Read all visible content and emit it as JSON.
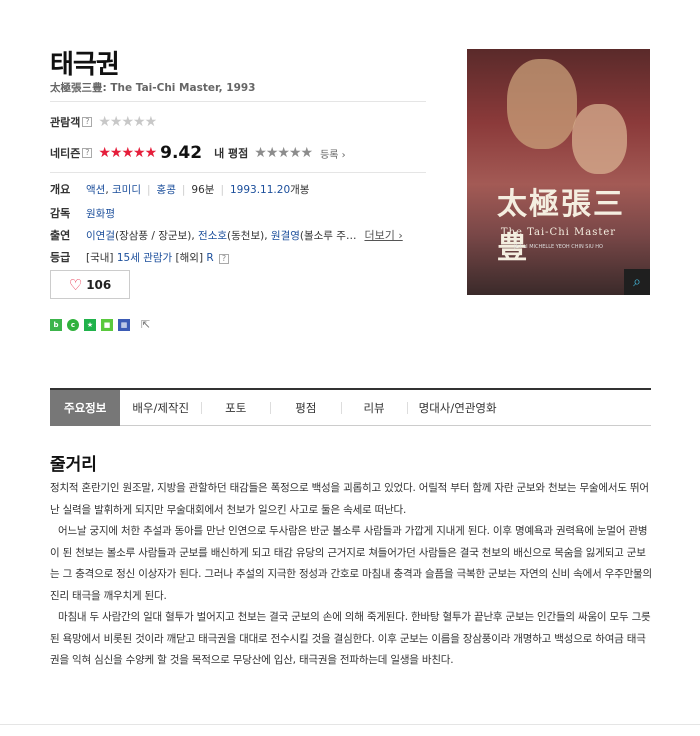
{
  "movie": {
    "title": "태극권",
    "subtitle": "太極張三豊: The Tai-Chi Master, 1993"
  },
  "ratings": {
    "audience_label": "관람객",
    "audience_help": "?",
    "netizen_label": "네티즌",
    "netizen_help": "?",
    "netizen_score": "9.42",
    "my_rating_label": "내 평점",
    "register_label": "등록 ›"
  },
  "info": {
    "overview_label": "개요",
    "genre_1": "액션",
    "genre_sep": ",",
    "genre_2": "코미디",
    "country": "홍콩",
    "runtime": "96분",
    "release_date": "1993.11.20",
    "release_suffix": "개봉",
    "director_label": "감독",
    "director": "원화평",
    "cast_label": "출연",
    "cast_1": "이연걸",
    "cast_1_role": "(장삼풍 / 장군보)",
    "cast_2": "전소호",
    "cast_2_role": "(동천보)",
    "cast_3": "원결영",
    "cast_3_role": "(볼소루 주…",
    "more_label": "더보기 ›",
    "rating_label": "등급",
    "rating_domestic": "[국내]",
    "rating_domestic_value": "15세 관람가",
    "rating_foreign": "[해외]",
    "rating_foreign_value": "R",
    "rating_help": "?"
  },
  "like": {
    "count": "106"
  },
  "poster": {
    "title_text": "太極張三豊",
    "english_title": "The Tai-Chi Master",
    "credits": "JET LI  MICHELLE YEOH  CHIN SIU HO",
    "zoom_icon": "magnifier-icon"
  },
  "tabs": [
    "주요정보",
    "배우/제작진",
    "포토",
    "평점",
    "리뷰",
    "명대사/연관영화"
  ],
  "synopsis": {
    "heading": "줄거리",
    "paragraphs": [
      "정치적 혼란기인 원조말, 지방을 관할하던 태감들은 폭정으로 백성을 괴롭히고 있었다. 어릴적 부터 함께 자란 군보와 천보는 무술에서도 뛰어난 실력을 발휘하게 되지만 무술대회에서 천보가 일으킨 사고로 둘은 속세로 떠난다.",
      "어느날 궁지에 처한 추설과 동아를 만난 인연으로 두사람은 반군 볼소루 사람들과 가깝게 지내게 된다. 이후 명예욕과 권력욕에 눈멀어 관병이 된 천보는 볼소루 사람들과 군보를 배신하게 되고 태감 유당의 근거지로 쳐들어가던 사람들은 결국 천보의 배신으로 목숨을 잃게되고 군보는 그 충격으로 정신 이상자가 된다. 그러나 추설의 지극한 정성과 간호로 마침내 충격과 슬픔을 극복한 군보는 자연의 신비 속에서 우주만물의 진리 태극을 깨우치게 된다.",
      "마침내 두 사람간의 일대 혈투가 벌어지고 천보는 결국 군보의 손에 의해 죽게된다. 한바탕 혈투가 끝난후 군보는 인간들의 싸움이 모두 그릇된 욕망에서 비롯된 것이라 깨닫고 태극권을 대대로 전수시킬 것을 결심한다. 이후 군보는 이름을 장삼풍이라 개명하고 백성으로 하여금 태극권을 익혀 심신을 수양케 할 것을 목적으로 무당산에 입산, 태극권을 전파하는데 일생을 바친다."
    ]
  },
  "colors": {
    "star_red": "#e51e3b",
    "star_gray": "#c8c8c8",
    "link_blue": "#1b4e9b",
    "tab_active_bg": "#777777"
  }
}
